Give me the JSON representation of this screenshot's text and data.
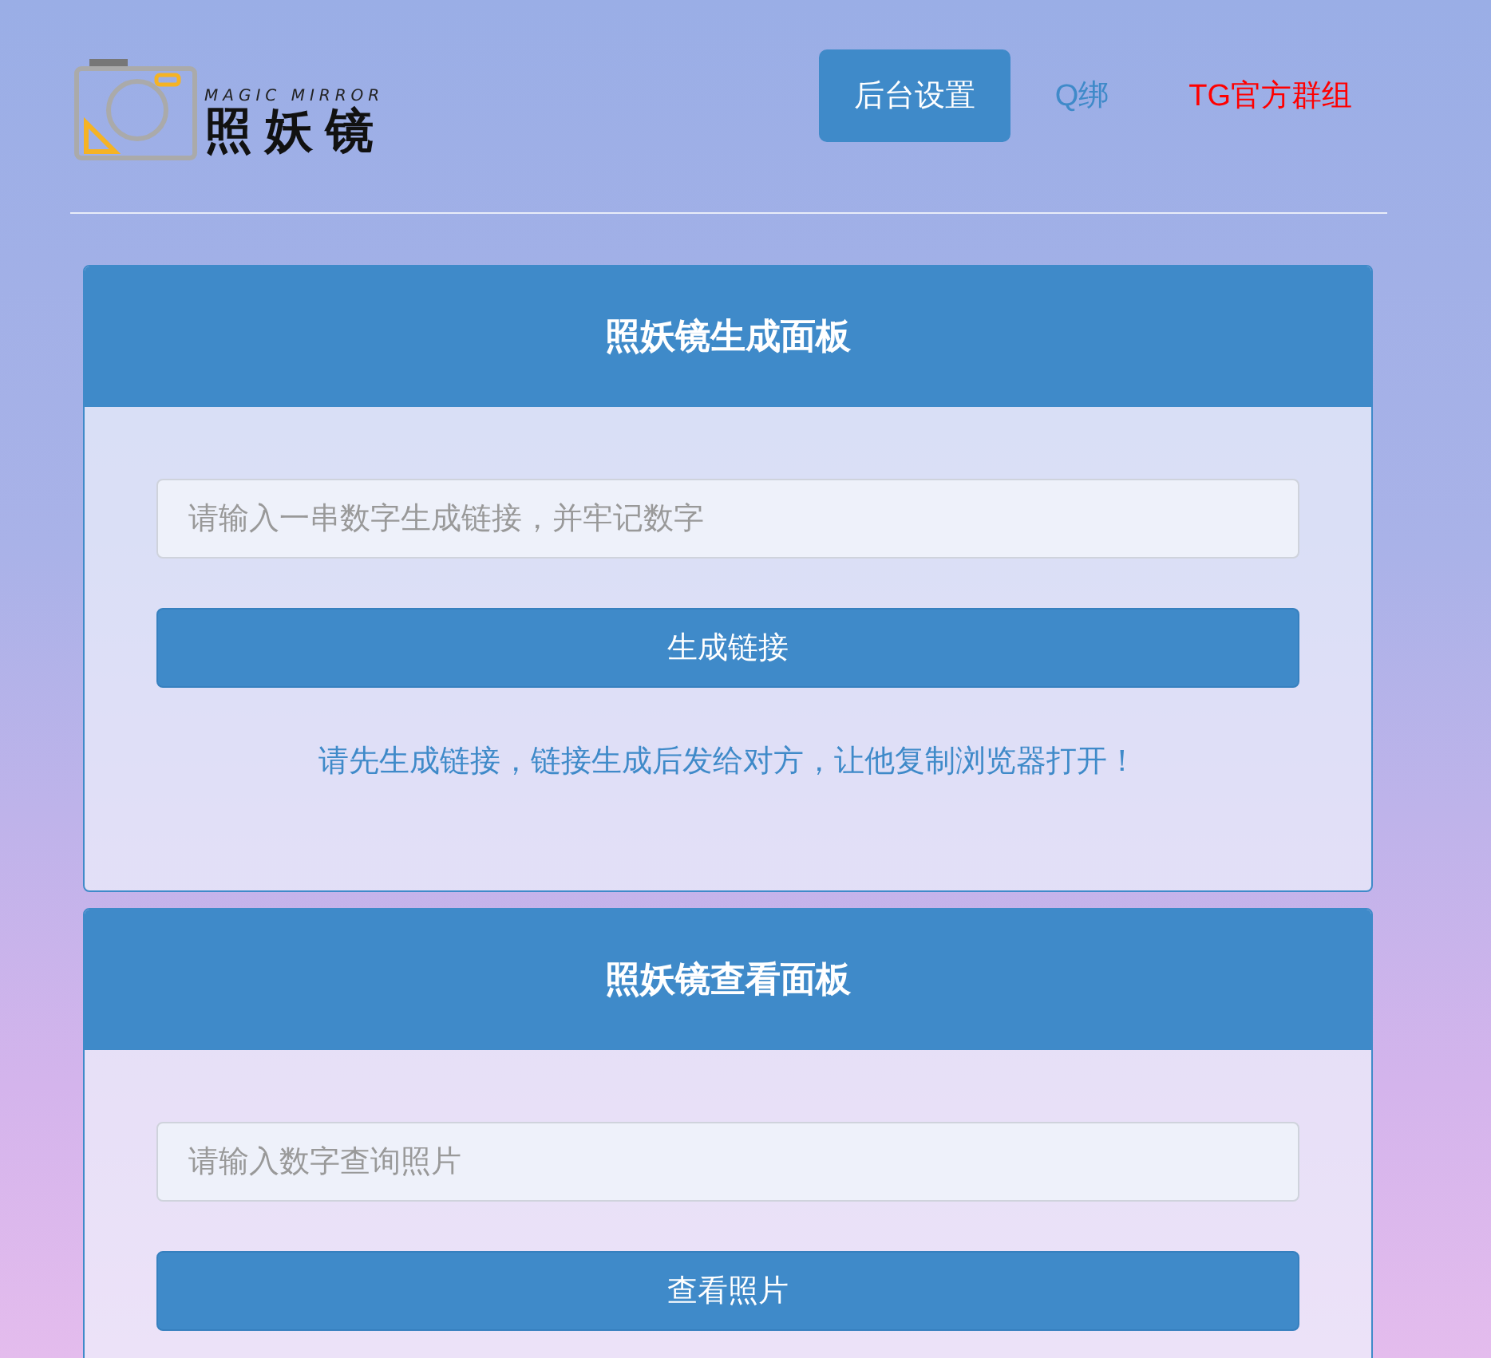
{
  "logo": {
    "tagline": "MAGIC MIRROR",
    "name": "照妖镜"
  },
  "nav": [
    {
      "label": "后台设置",
      "selected": true
    },
    {
      "label": "Q绑",
      "selected": false,
      "color": "#3f8ac9"
    },
    {
      "label": "TG官方群组",
      "selected": false,
      "color": "#ff0000"
    }
  ],
  "panels": [
    {
      "title": "照妖镜生成面板",
      "placeholder": "请输入一串数字生成链接，并牢记数字",
      "button": "生成链接",
      "note": "请先生成链接，链接生成后发给对方，让他复制浏览器打开！"
    },
    {
      "title": "照妖镜查看面板",
      "placeholder": "请输入数字查询照片",
      "button": "查看照片"
    }
  ]
}
